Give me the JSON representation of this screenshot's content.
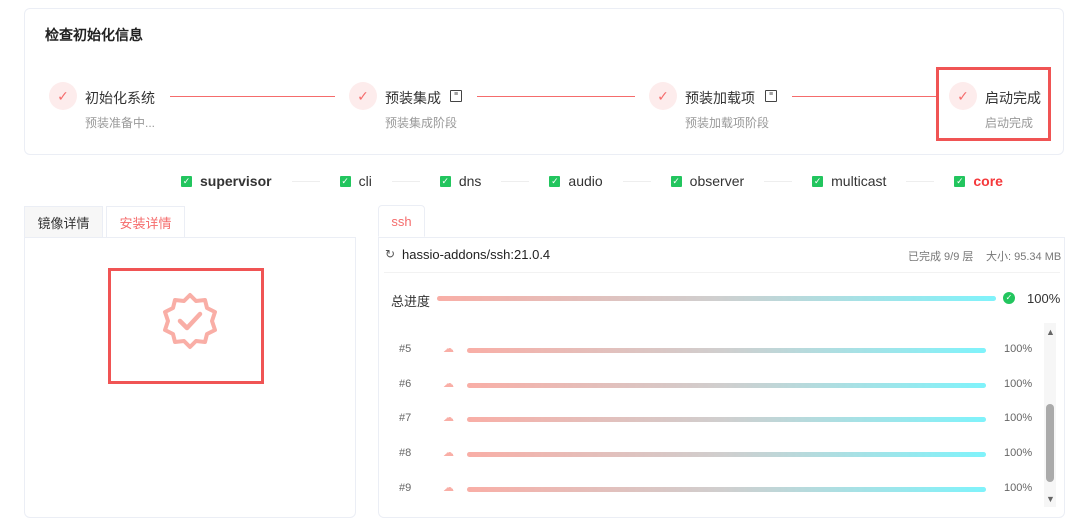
{
  "card": {
    "title": "检查初始化信息",
    "steps": [
      {
        "title": "初始化系统",
        "subtitle": "预装准备中...",
        "has_doc_icon": false
      },
      {
        "title": "预装集成",
        "subtitle": "预装集成阶段",
        "has_doc_icon": true
      },
      {
        "title": "预装加载项",
        "subtitle": "预装加载项阶段",
        "has_doc_icon": true
      },
      {
        "title": "启动完成",
        "subtitle": "启动完成",
        "has_doc_icon": false
      }
    ]
  },
  "status": [
    {
      "label": "supervisor",
      "checked": true
    },
    {
      "label": "cli",
      "checked": true
    },
    {
      "label": "dns",
      "checked": true
    },
    {
      "label": "audio",
      "checked": true
    },
    {
      "label": "observer",
      "checked": true
    },
    {
      "label": "multicast",
      "checked": true
    },
    {
      "label": "core",
      "checked": true,
      "color": "#f5383b"
    }
  ],
  "left": {
    "tabs": [
      "镜像详情",
      "安装详情"
    ],
    "active_tab": "安装详情"
  },
  "right": {
    "tab": "ssh",
    "image": "hassio-addons/ssh:21.0.4",
    "completed": "已完成 9/9 层",
    "size": "大小: 95.34 MB",
    "total_label": "总进度",
    "total_pct": "100%",
    "total_value": 100,
    "layers": [
      {
        "id": "#5",
        "pct": "100%",
        "value": 100
      },
      {
        "id": "#6",
        "pct": "100%",
        "value": 100
      },
      {
        "id": "#7",
        "pct": "100%",
        "value": 100
      },
      {
        "id": "#8",
        "pct": "100%",
        "value": 100
      },
      {
        "id": "#9",
        "pct": "100%",
        "value": 100
      }
    ]
  },
  "colors": {
    "accent": "#f56c6c",
    "success": "#22c55e",
    "highlight": "#f05454"
  }
}
